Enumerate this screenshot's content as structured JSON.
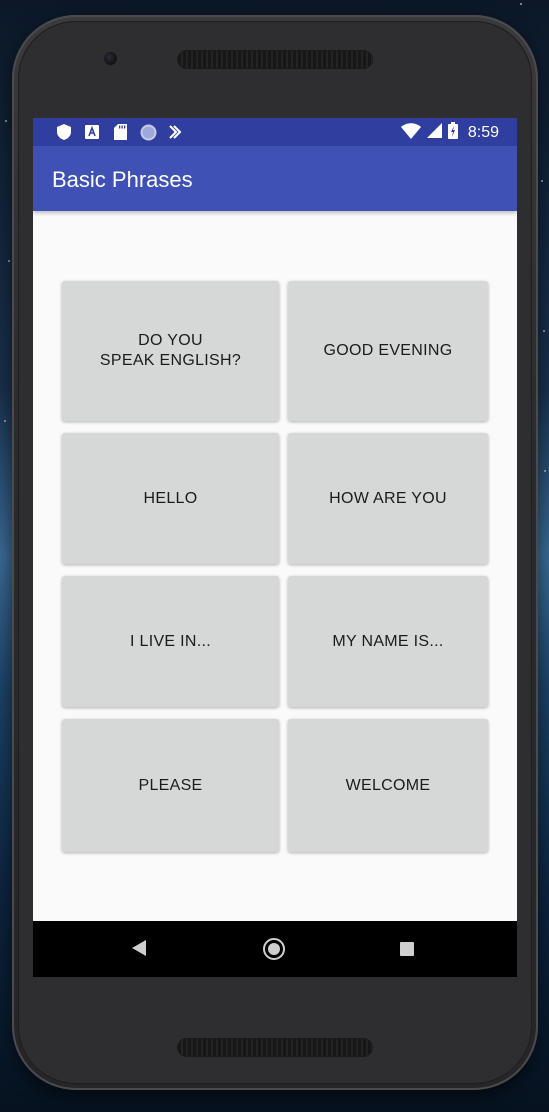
{
  "status_bar": {
    "time": "8:59",
    "left_icons": [
      "shield-icon",
      "font-a-icon",
      "sd-card-icon",
      "circle-icon",
      "check-sync-icon"
    ],
    "right_icons": [
      "wifi-icon",
      "signal-icon",
      "battery-charging-icon"
    ],
    "background_color": "#303f9f"
  },
  "app_bar": {
    "title": "Basic Phrases",
    "background_color": "#3f51b5"
  },
  "phrases": [
    {
      "label": "DO YOU\nSPEAK ENGLISH?"
    },
    {
      "label": "GOOD EVENING"
    },
    {
      "label": "HELLO"
    },
    {
      "label": "HOW ARE YOU"
    },
    {
      "label": "I LIVE IN..."
    },
    {
      "label": "MY NAME IS..."
    },
    {
      "label": "PLEASE"
    },
    {
      "label": "WELCOME"
    }
  ],
  "nav_bar": {
    "icons": [
      "back-icon",
      "home-icon",
      "recents-icon"
    ]
  }
}
